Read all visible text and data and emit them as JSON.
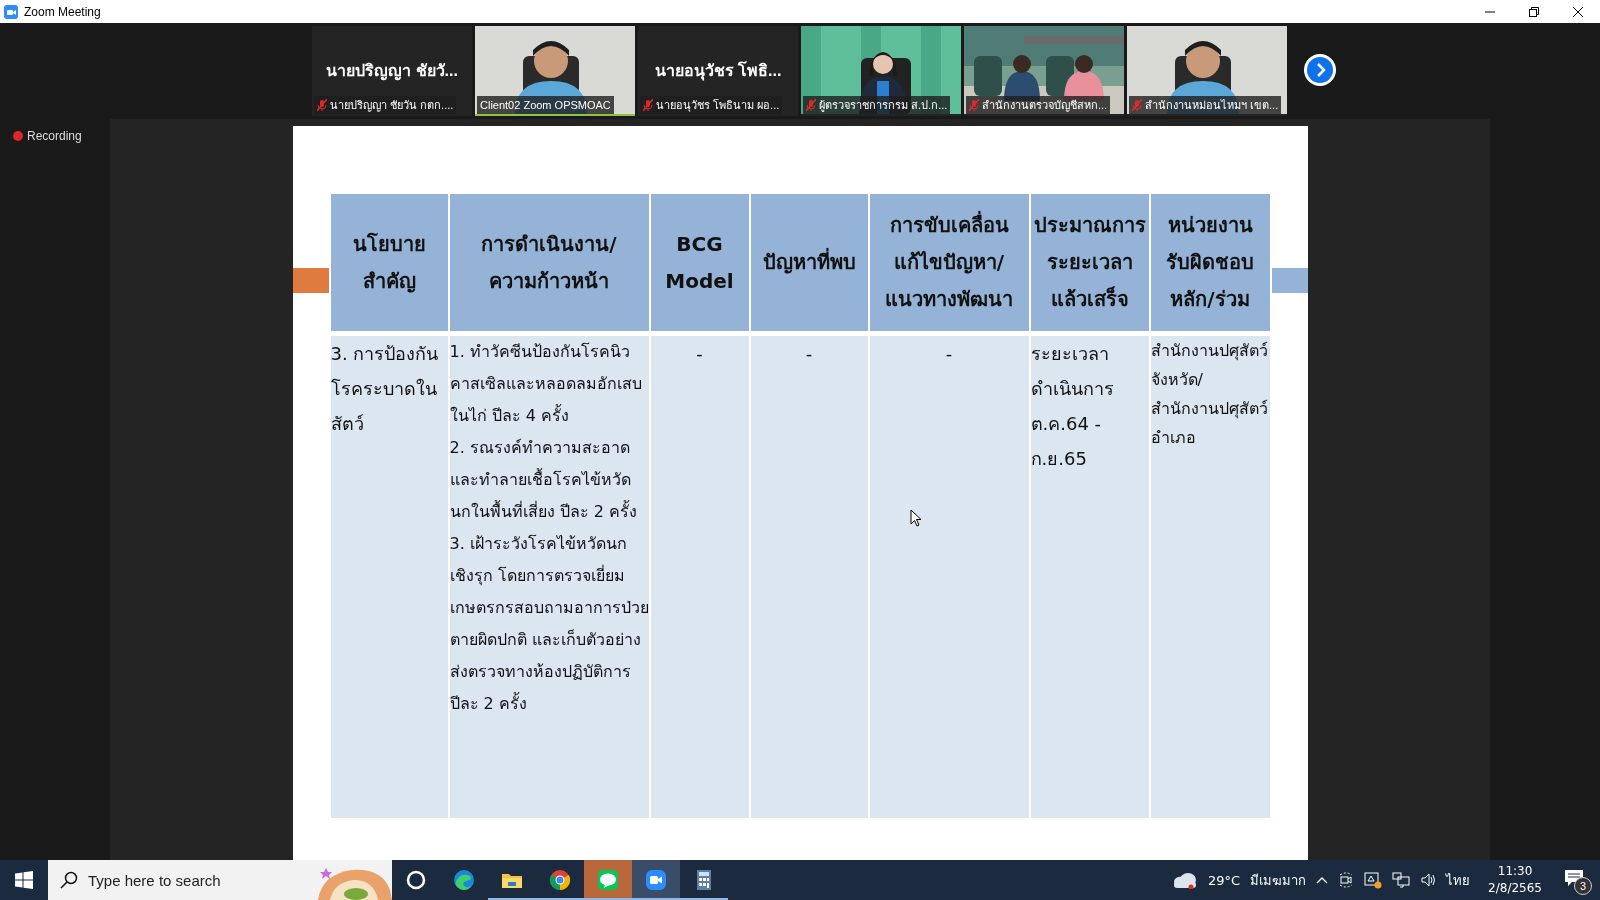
{
  "window": {
    "title": "Zoom Meeting"
  },
  "participants": [
    {
      "kind": "name",
      "name": "นายปริญญา ชัยวั...",
      "label": "นายปริญญา ชัยวัน กตก....",
      "muted": true,
      "active_speaker": false
    },
    {
      "kind": "video",
      "label": "Client02 Zoom OPSMOAC",
      "muted": false,
      "active_speaker": true
    },
    {
      "kind": "name",
      "name": "นายอนุวัชร โพธิ...",
      "label": "นายอนุวัชร โพธินาม ผอ...",
      "muted": true,
      "active_speaker": false
    },
    {
      "kind": "video",
      "label": "ผู้ตรวจราชการกรม ส.ป.ก...",
      "muted": true,
      "active_speaker": false
    },
    {
      "kind": "video",
      "label": "สำนักงานตรวจบัญชีสหก...",
      "muted": true,
      "active_speaker": false
    },
    {
      "kind": "video",
      "label": "สำนักงานหม่อนไหมฯ เขต...",
      "muted": true,
      "active_speaker": false
    }
  ],
  "recording": {
    "label": "Recording"
  },
  "slide": {
    "table": {
      "columns": [
        "นโยบาย\nสำคัญ",
        "การดำเนินงาน/\nความก้าวหน้า",
        "BCG\nModel",
        "ปัญหาที่พบ",
        "การขับเคลื่อน\nแก้ไขปัญหา/\nแนวทางพัฒนา",
        "ประมาณการ\nระยะเวลา\nแล้วเสร็จ",
        "หน่วยงาน\nรับผิดชอบ\nหลัก/ร่วม"
      ],
      "rows": [
        {
          "cells": [
            "3. การป้องกันโรคระบาดในสัตว์",
            "1. ทำวัคซีนป้องกันโรคนิวคาสเซิลและหลอดลมอักเสบในไก่ ปีละ 4 ครั้ง\n2. รณรงค์ทำความสะอาดและทำลายเชื้อโรคไข้หวัดนกในพื้นที่เสี่ยง ปีละ 2 ครั้ง\n3. เฝ้าระวังโรคไข้หวัดนกเชิงรุก โดยการตรวจเยี่ยมเกษตรกรสอบถามอาการป่วยตายผิดปกติ และเก็บตัวอย่างส่งตรวจทางห้องปฏิบัติการ ปีละ 2 ครั้ง",
            "-",
            "-",
            "-",
            "ระยะเวลาดำเนินการ ต.ค.64 - ก.ย.65",
            "สำนักงานปศุสัตว์จังหวัด/สำนักงานปศุสัตว์อำเภอ"
          ]
        }
      ]
    }
  },
  "taskbar": {
    "search": {
      "placeholder": "Type here to search"
    },
    "apps": [
      {
        "kind": "cortana",
        "running": false,
        "flashing": false,
        "active": false
      },
      {
        "kind": "edge",
        "running": false,
        "flashing": false,
        "active": false
      },
      {
        "kind": "explorer",
        "running": true,
        "flashing": false,
        "active": false
      },
      {
        "kind": "chrome",
        "running": true,
        "flashing": false,
        "active": false
      },
      {
        "kind": "line",
        "running": true,
        "flashing": true,
        "active": false
      },
      {
        "kind": "zoom",
        "running": true,
        "flashing": false,
        "active": true
      },
      {
        "kind": "calculator",
        "running": true,
        "flashing": false,
        "active": false
      }
    ],
    "weather": {
      "temperature": "29°C",
      "condition": "มีเมฆมาก"
    },
    "language": "ไทย",
    "time": "11:30",
    "date": "2/8/2565",
    "notifications": "3"
  }
}
